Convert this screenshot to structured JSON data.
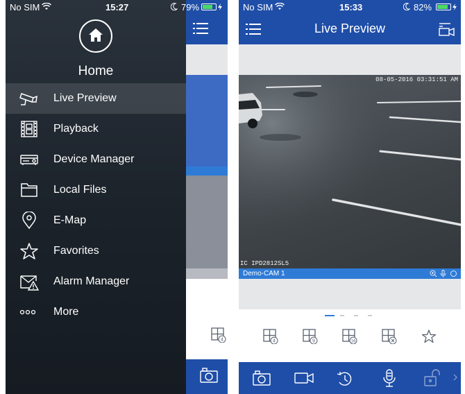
{
  "left": {
    "status": {
      "carrier": "No SIM",
      "time": "15:27",
      "battery": "79%",
      "battery_level": 0.79
    },
    "home_label": "Home",
    "menu": [
      {
        "label": "Live Preview",
        "icon": "cctv-camera-icon",
        "active": true
      },
      {
        "label": "Playback",
        "icon": "film-strip-icon"
      },
      {
        "label": "Device Manager",
        "icon": "dvr-device-icon"
      },
      {
        "label": "Local Files",
        "icon": "folder-icon"
      },
      {
        "label": "E-Map",
        "icon": "map-pin-icon"
      },
      {
        "label": "Favorites",
        "icon": "star-icon"
      },
      {
        "label": "Alarm Manager",
        "icon": "alarm-envelope-icon"
      },
      {
        "label": "More",
        "icon": "more-dots-icon"
      }
    ]
  },
  "right": {
    "status": {
      "carrier": "No SIM",
      "time": "15:33",
      "battery": "82%",
      "battery_level": 0.82
    },
    "title": "Live Preview",
    "video": {
      "timestamp": "08-05-2016 03:31:51 AM",
      "osd": "IC IPD2812SL5",
      "camera_name": "Demo-CAM 1"
    },
    "page_dots": 4,
    "active_page": 0,
    "window_counts": [
      "4",
      "4",
      "9",
      "16"
    ]
  },
  "colors": {
    "nav_blue": "#1f4ea8",
    "cam_bar_blue": "#2e7bd6",
    "drawer_dark": "#1b222a",
    "battery_green": "#4cd964"
  }
}
